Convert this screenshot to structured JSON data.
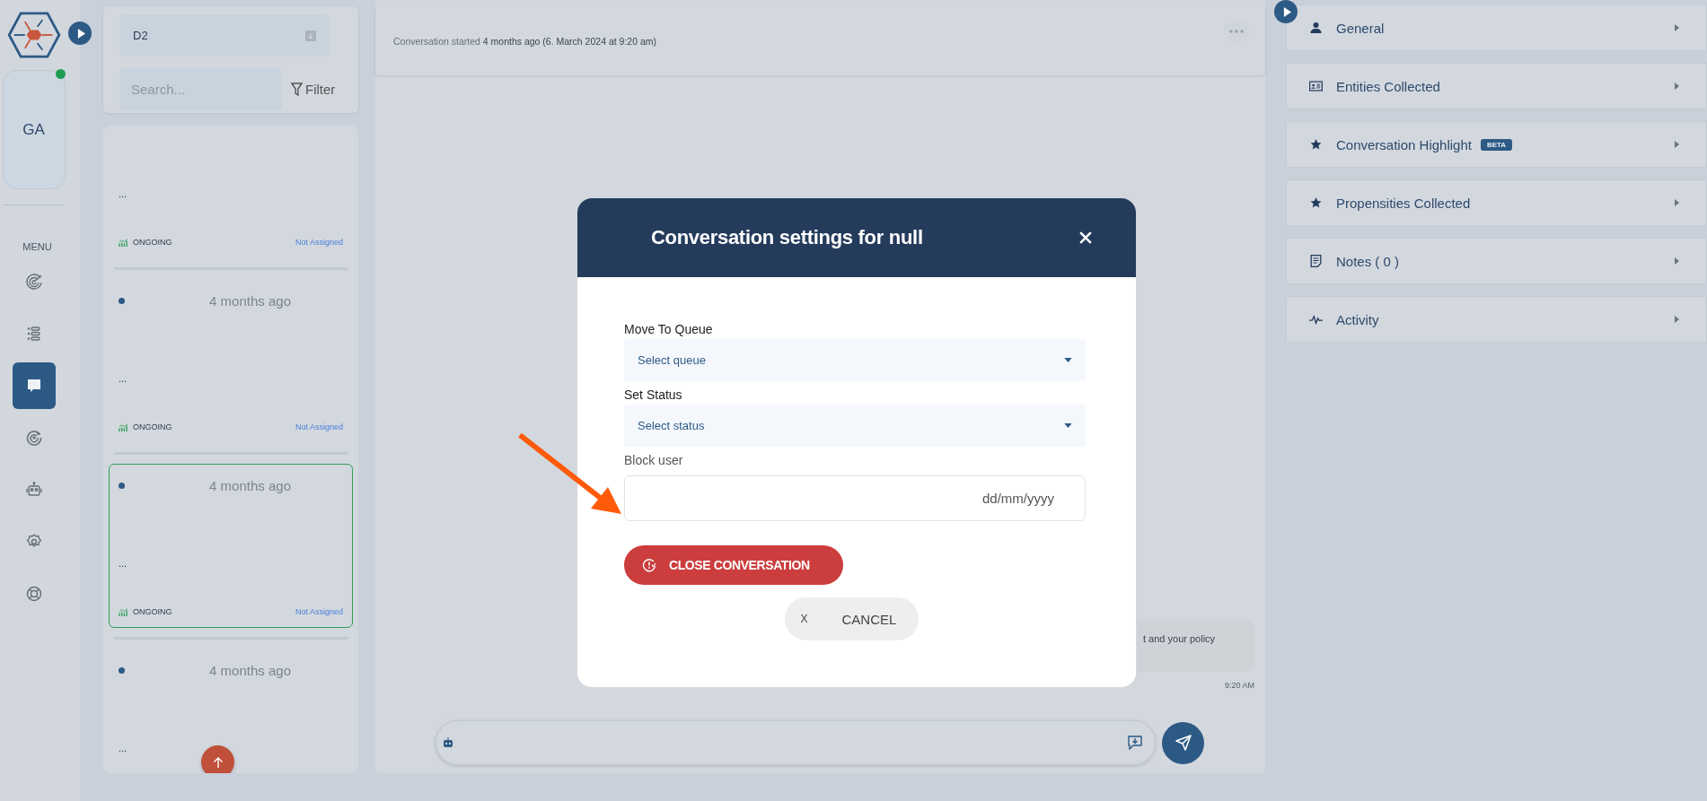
{
  "nav": {
    "avatar": "GA",
    "online": true,
    "menu_label": "MENU",
    "items": [
      {
        "kind": "radar",
        "selected": false
      },
      {
        "kind": "list",
        "selected": false
      },
      {
        "kind": "chat",
        "selected": true
      },
      {
        "kind": "target",
        "selected": false
      },
      {
        "kind": "robot",
        "selected": false
      },
      {
        "kind": "settings",
        "selected": false
      },
      {
        "kind": "lifebuoy",
        "selected": false
      }
    ]
  },
  "conversation_filter": {
    "dropdown": "D2",
    "search_placeholder": "Search...",
    "filter": "Filter"
  },
  "conversations": [
    {
      "preview": "...",
      "status": "ONGOING",
      "assignee": "Not Assigned",
      "selected": false
    },
    {
      "unread": true,
      "time": "4 months ago",
      "preview": "...",
      "status": "ONGOING",
      "assignee": "Not Assigned",
      "selected": false
    },
    {
      "unread": true,
      "time": "4 months ago",
      "preview": "...",
      "status": "ONGOING",
      "assignee": "Not Assigned",
      "selected": true
    },
    {
      "unread": true,
      "time": "4 months ago",
      "preview": "..."
    }
  ],
  "chat": {
    "header": "Conversation started **4 months ago (6. March 2024 at 9:20 am)**",
    "messages": [
      {
        "text": "t and your policy",
        "time": "9:20 AM"
      }
    ]
  },
  "details": [
    {
      "kind": "person",
      "label": "General"
    },
    {
      "kind": "card",
      "label": "Entities Collected"
    },
    {
      "kind": "star",
      "label": "Conversation Highlight",
      "badge": "BETA"
    },
    {
      "kind": "star",
      "label": "Propensities Collected"
    },
    {
      "kind": "notes",
      "label": "Notes ( 0 )"
    },
    {
      "kind": "activity",
      "label": "Activity"
    }
  ],
  "modal": {
    "title": "Conversation settings for null",
    "fields": [
      {
        "kind": "select",
        "label": "Move To Queue",
        "placeholder": "Select queue"
      },
      {
        "kind": "select",
        "label": "Set Status",
        "placeholder": "Select status"
      },
      {
        "kind": "date",
        "label": "Block user",
        "placeholder": "dd/mm/yyyy"
      }
    ],
    "close_conversation": "CLOSE CONVERSATION",
    "cancel": {
      "mark": "X",
      "label": "CANCEL"
    }
  }
}
